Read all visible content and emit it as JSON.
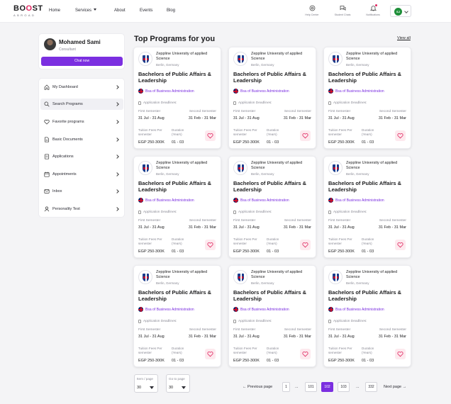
{
  "header": {
    "logo": {
      "main_a": "BO",
      "main_o": "O",
      "main_b": "ST",
      "sub": "ABROAD"
    },
    "nav": [
      {
        "label": "Home"
      },
      {
        "label": "Services"
      },
      {
        "label": "About"
      },
      {
        "label": "Events"
      },
      {
        "label": "Blog"
      }
    ],
    "icons": [
      {
        "label": "Help Center",
        "icon": "help-center-icon"
      },
      {
        "label": "Student Chats",
        "icon": "chats-icon"
      },
      {
        "label": "Notifications",
        "icon": "bell-icon"
      }
    ],
    "user_initials": "SJ"
  },
  "profile": {
    "name": "Mohamed Sami",
    "role": "Consultant",
    "chat_label": "Chat now"
  },
  "sidebar": {
    "items": [
      {
        "label": "My Dashboard",
        "icon": "home-icon"
      },
      {
        "label": "Search Programs",
        "icon": "search-icon",
        "active": true
      },
      {
        "label": "Favorite programs",
        "icon": "heart-icon"
      },
      {
        "label": "Basic Documents",
        "icon": "document-icon"
      },
      {
        "label": "Applications",
        "icon": "applications-icon"
      },
      {
        "label": "Appointments",
        "icon": "calendar-icon"
      },
      {
        "label": "Inbox",
        "icon": "mail-icon"
      },
      {
        "label": "Personality Test",
        "icon": "person-icon"
      }
    ]
  },
  "main": {
    "title": "Top Programs for you",
    "view_all": "View all",
    "card_template": {
      "university": "Zeppline University of applied Science",
      "location": "Berlin, Germany",
      "program": "Bachelors of Public Affairs & Leadership",
      "school": "Bsa of Business Administration",
      "deadline_label": "Application Deadlines:",
      "first_sem_label": "First Semester",
      "first_sem_value": "31 Jul - 31 Aug",
      "second_sem_label": "Second Semester",
      "second_sem_value": "31 Feb - 31 Mar",
      "fees_label": "Tuition Fees Per semester",
      "fees_value": "EGP 250-300K",
      "duration_label": "Duration (Years)",
      "duration_value": "01 - 03"
    },
    "card_count": 9
  },
  "pagination": {
    "items_per_page_label": "Item / page",
    "items_per_page_value": "30",
    "goto_label": "Go to page",
    "goto_value": "30",
    "prev_label": "Previous page",
    "next_label": "Next page",
    "pages": [
      "1",
      "...",
      "101",
      "102",
      "103",
      "...",
      "332"
    ],
    "current": "102"
  },
  "colors": {
    "accent": "#7b2fe0",
    "brand_pink": "#e0245e",
    "fav_bg": "#fde9ee"
  }
}
